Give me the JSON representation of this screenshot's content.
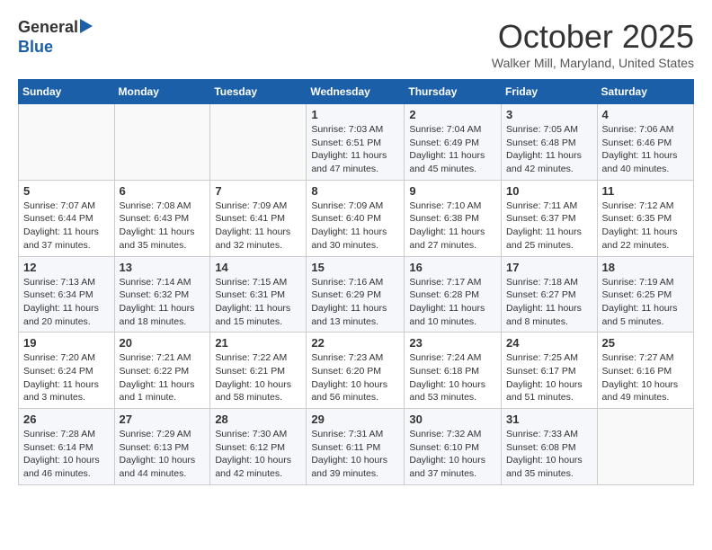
{
  "header": {
    "logo_line1": "General",
    "logo_line2": "Blue",
    "month": "October 2025",
    "location": "Walker Mill, Maryland, United States"
  },
  "days_of_week": [
    "Sunday",
    "Monday",
    "Tuesday",
    "Wednesday",
    "Thursday",
    "Friday",
    "Saturday"
  ],
  "weeks": [
    [
      {
        "day": "",
        "info": ""
      },
      {
        "day": "",
        "info": ""
      },
      {
        "day": "",
        "info": ""
      },
      {
        "day": "1",
        "info": "Sunrise: 7:03 AM\nSunset: 6:51 PM\nDaylight: 11 hours and 47 minutes."
      },
      {
        "day": "2",
        "info": "Sunrise: 7:04 AM\nSunset: 6:49 PM\nDaylight: 11 hours and 45 minutes."
      },
      {
        "day": "3",
        "info": "Sunrise: 7:05 AM\nSunset: 6:48 PM\nDaylight: 11 hours and 42 minutes."
      },
      {
        "day": "4",
        "info": "Sunrise: 7:06 AM\nSunset: 6:46 PM\nDaylight: 11 hours and 40 minutes."
      }
    ],
    [
      {
        "day": "5",
        "info": "Sunrise: 7:07 AM\nSunset: 6:44 PM\nDaylight: 11 hours and 37 minutes."
      },
      {
        "day": "6",
        "info": "Sunrise: 7:08 AM\nSunset: 6:43 PM\nDaylight: 11 hours and 35 minutes."
      },
      {
        "day": "7",
        "info": "Sunrise: 7:09 AM\nSunset: 6:41 PM\nDaylight: 11 hours and 32 minutes."
      },
      {
        "day": "8",
        "info": "Sunrise: 7:09 AM\nSunset: 6:40 PM\nDaylight: 11 hours and 30 minutes."
      },
      {
        "day": "9",
        "info": "Sunrise: 7:10 AM\nSunset: 6:38 PM\nDaylight: 11 hours and 27 minutes."
      },
      {
        "day": "10",
        "info": "Sunrise: 7:11 AM\nSunset: 6:37 PM\nDaylight: 11 hours and 25 minutes."
      },
      {
        "day": "11",
        "info": "Sunrise: 7:12 AM\nSunset: 6:35 PM\nDaylight: 11 hours and 22 minutes."
      }
    ],
    [
      {
        "day": "12",
        "info": "Sunrise: 7:13 AM\nSunset: 6:34 PM\nDaylight: 11 hours and 20 minutes."
      },
      {
        "day": "13",
        "info": "Sunrise: 7:14 AM\nSunset: 6:32 PM\nDaylight: 11 hours and 18 minutes."
      },
      {
        "day": "14",
        "info": "Sunrise: 7:15 AM\nSunset: 6:31 PM\nDaylight: 11 hours and 15 minutes."
      },
      {
        "day": "15",
        "info": "Sunrise: 7:16 AM\nSunset: 6:29 PM\nDaylight: 11 hours and 13 minutes."
      },
      {
        "day": "16",
        "info": "Sunrise: 7:17 AM\nSunset: 6:28 PM\nDaylight: 11 hours and 10 minutes."
      },
      {
        "day": "17",
        "info": "Sunrise: 7:18 AM\nSunset: 6:27 PM\nDaylight: 11 hours and 8 minutes."
      },
      {
        "day": "18",
        "info": "Sunrise: 7:19 AM\nSunset: 6:25 PM\nDaylight: 11 hours and 5 minutes."
      }
    ],
    [
      {
        "day": "19",
        "info": "Sunrise: 7:20 AM\nSunset: 6:24 PM\nDaylight: 11 hours and 3 minutes."
      },
      {
        "day": "20",
        "info": "Sunrise: 7:21 AM\nSunset: 6:22 PM\nDaylight: 11 hours and 1 minute."
      },
      {
        "day": "21",
        "info": "Sunrise: 7:22 AM\nSunset: 6:21 PM\nDaylight: 10 hours and 58 minutes."
      },
      {
        "day": "22",
        "info": "Sunrise: 7:23 AM\nSunset: 6:20 PM\nDaylight: 10 hours and 56 minutes."
      },
      {
        "day": "23",
        "info": "Sunrise: 7:24 AM\nSunset: 6:18 PM\nDaylight: 10 hours and 53 minutes."
      },
      {
        "day": "24",
        "info": "Sunrise: 7:25 AM\nSunset: 6:17 PM\nDaylight: 10 hours and 51 minutes."
      },
      {
        "day": "25",
        "info": "Sunrise: 7:27 AM\nSunset: 6:16 PM\nDaylight: 10 hours and 49 minutes."
      }
    ],
    [
      {
        "day": "26",
        "info": "Sunrise: 7:28 AM\nSunset: 6:14 PM\nDaylight: 10 hours and 46 minutes."
      },
      {
        "day": "27",
        "info": "Sunrise: 7:29 AM\nSunset: 6:13 PM\nDaylight: 10 hours and 44 minutes."
      },
      {
        "day": "28",
        "info": "Sunrise: 7:30 AM\nSunset: 6:12 PM\nDaylight: 10 hours and 42 minutes."
      },
      {
        "day": "29",
        "info": "Sunrise: 7:31 AM\nSunset: 6:11 PM\nDaylight: 10 hours and 39 minutes."
      },
      {
        "day": "30",
        "info": "Sunrise: 7:32 AM\nSunset: 6:10 PM\nDaylight: 10 hours and 37 minutes."
      },
      {
        "day": "31",
        "info": "Sunrise: 7:33 AM\nSunset: 6:08 PM\nDaylight: 10 hours and 35 minutes."
      },
      {
        "day": "",
        "info": ""
      }
    ]
  ]
}
